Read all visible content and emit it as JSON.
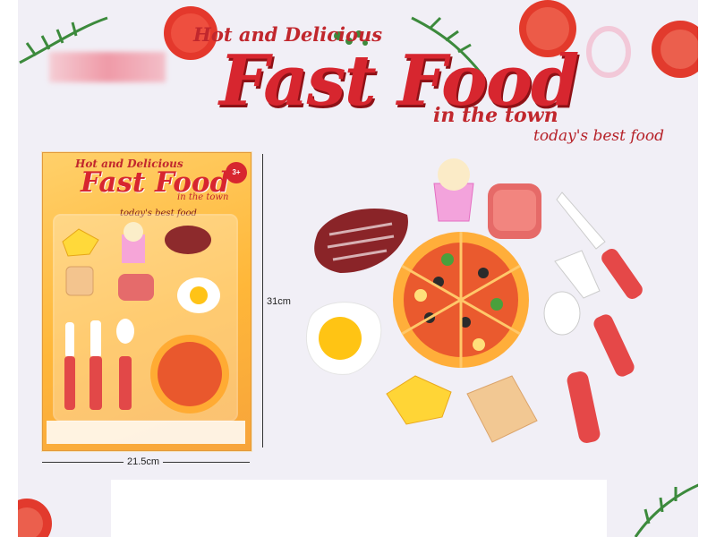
{
  "banner": {
    "line1": "Hot and Delicious",
    "title": "Fast Food",
    "line3": "in the town",
    "tagline": "today's best food"
  },
  "package": {
    "line1": "Hot and Delicious",
    "title": "Fast Food",
    "line3": "in the town",
    "tagline": "today's best food",
    "age_badge": "3+"
  },
  "dimensions": {
    "height": "31cm",
    "width": "21.5cm"
  },
  "colors": {
    "brand_red": "#d7262f",
    "pack_orange": "#ffb739",
    "background": "#f1eff6"
  }
}
